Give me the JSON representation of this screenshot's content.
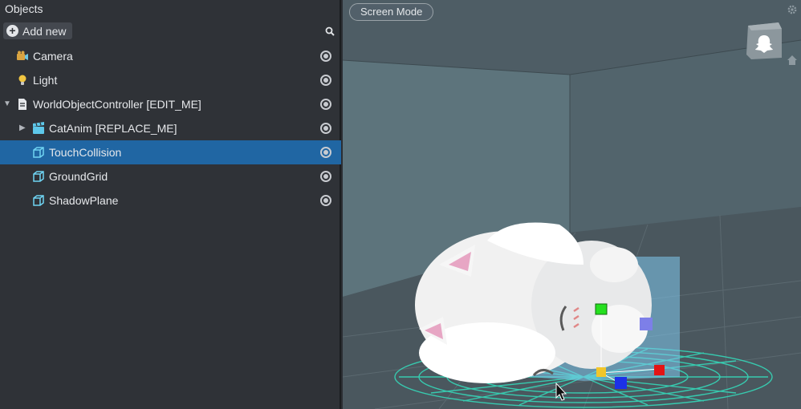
{
  "panel": {
    "title": "Objects",
    "add_new_label": "Add new"
  },
  "objects": [
    {
      "label": "Camera",
      "icon": "camera-icon",
      "selected": false
    },
    {
      "label": "Light",
      "icon": "lightbulb-icon",
      "selected": false
    },
    {
      "label": "WorldObjectController [EDIT_ME]",
      "icon": "script-icon",
      "selected": false,
      "expanded": true
    },
    {
      "label": "CatAnim [REPLACE_ME]",
      "icon": "animation-clapper-icon",
      "selected": false,
      "expanded": false
    },
    {
      "label": "TouchCollision",
      "icon": "cube-icon",
      "selected": true
    },
    {
      "label": "GroundGrid",
      "icon": "cube-icon",
      "selected": false
    },
    {
      "label": "ShadowPlane",
      "icon": "cube-icon",
      "selected": false
    }
  ],
  "viewport": {
    "screen_mode_label": "Screen Mode"
  },
  "colors": {
    "panel_bg": "#2f3237",
    "selection": "#2066a3",
    "viewport_bg": "#4b5a61",
    "grid_teal": "#36d1b4"
  }
}
